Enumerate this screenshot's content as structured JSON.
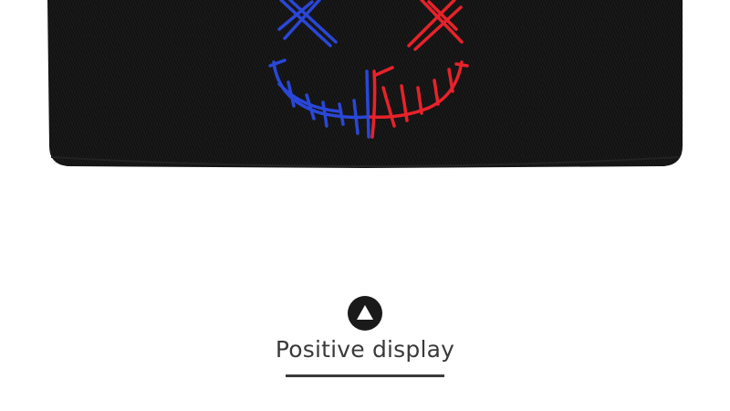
{
  "caption": {
    "text": "Positive display"
  },
  "icons": {
    "badge": "up-triangle-icon"
  },
  "colors": {
    "beanie": "#111111",
    "stitch_blue": "#2a47d8",
    "stitch_red": "#e8222a",
    "badge_bg": "#1a1a1a",
    "text": "#3a3a3a"
  }
}
